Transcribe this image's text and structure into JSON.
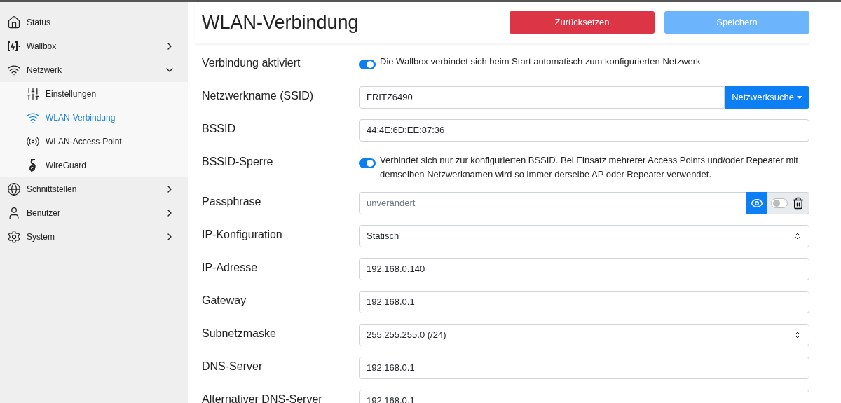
{
  "sidebar": {
    "items": [
      {
        "label": "Status",
        "selected": false
      },
      {
        "label": "Wallbox",
        "selected": false,
        "expanded": false
      },
      {
        "label": "Netzwerk",
        "selected": false,
        "expanded": true,
        "children": [
          {
            "label": "Einstellungen",
            "selected": false
          },
          {
            "label": "WLAN-Verbindung",
            "selected": true
          },
          {
            "label": "WLAN-Access-Point",
            "selected": false
          },
          {
            "label": "WireGuard",
            "selected": false
          }
        ]
      },
      {
        "label": "Schnittstellen",
        "selected": false,
        "expanded": false
      },
      {
        "label": "Benutzer",
        "selected": false,
        "expanded": false
      },
      {
        "label": "System",
        "selected": false,
        "expanded": false
      }
    ]
  },
  "header": {
    "title": "WLAN-Verbindung",
    "buttons": [
      {
        "label": "Zurücksetzen",
        "kind": "danger",
        "disabled": false
      },
      {
        "label": "Speichern",
        "kind": "primary",
        "disabled": true
      }
    ]
  },
  "form": {
    "rows": [
      {
        "label": "Verbindung aktiviert",
        "kind": "toggle",
        "on": true,
        "text": "Die Wallbox verbindet sich beim Start automatisch zum konfigurierten Netzwerk"
      },
      {
        "label": "Netzwerkname (SSID)",
        "kind": "input_button",
        "value": "FRITZ6490",
        "button": "Netzwerksuche"
      },
      {
        "label": "BSSID",
        "kind": "input",
        "value": "44:4E:6D:EE:87:36"
      },
      {
        "label": "BSSID-Sperre",
        "kind": "toggle",
        "on": true,
        "text": "Verbindet sich nur zur konfigurierten BSSID. Bei Einsatz mehrerer Access Points und/oder Repeater mit demselben Netzwerknamen wird so immer derselbe AP oder Repeater verwendet."
      },
      {
        "label": "Passphrase",
        "kind": "password",
        "placeholder": "unverändert",
        "clear_on": false
      },
      {
        "label": "IP-Konfiguration",
        "kind": "select",
        "value": "Statisch"
      },
      {
        "label": "IP-Adresse",
        "kind": "input",
        "value": "192.168.0.140"
      },
      {
        "label": "Gateway",
        "kind": "input",
        "value": "192.168.0.1"
      },
      {
        "label": "Subnetzmaske",
        "kind": "select",
        "value": "255.255.255.0 (/24)"
      },
      {
        "label": "DNS-Server",
        "kind": "input",
        "value": "192.168.0.1"
      },
      {
        "label": "Alternativer DNS-Server",
        "kind": "input",
        "value": "192.168.0.1"
      }
    ]
  }
}
